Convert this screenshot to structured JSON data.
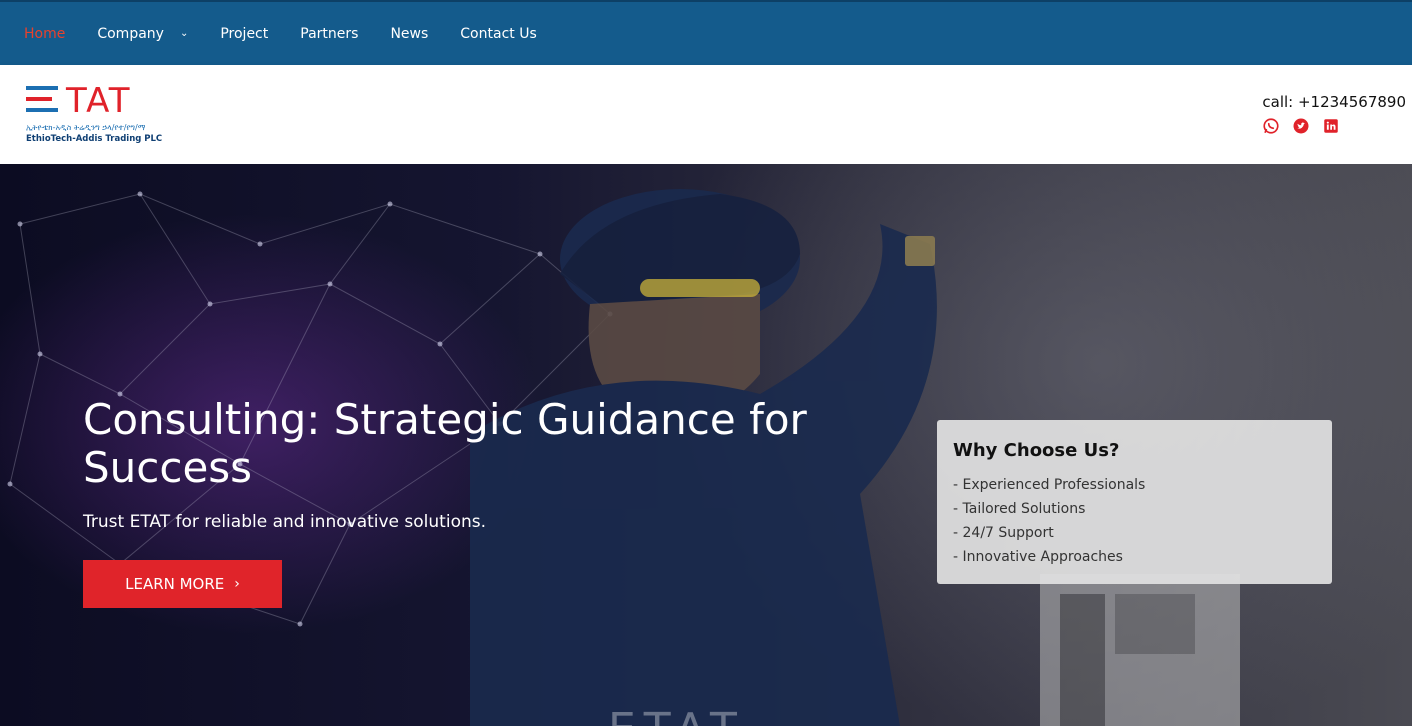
{
  "nav": {
    "items": [
      {
        "label": "Home",
        "active": true
      },
      {
        "label": "Company",
        "has_dropdown": true
      },
      {
        "label": "Project"
      },
      {
        "label": "Partners"
      },
      {
        "label": "News"
      },
      {
        "label": "Contact Us"
      }
    ],
    "background": "#145b8c",
    "active_color": "#e8412c"
  },
  "header": {
    "logo": {
      "mark": "TAT",
      "amharic": "ኢትዮቴክ-አዲስ ትሬዲንግ ኃላ/የተ/የግ/ማ",
      "company": "EthioTech-Addis Trading PLC"
    },
    "phone": "call: +1234567890",
    "social_icons": [
      "whatsapp-icon",
      "twitter-icon",
      "linkedin-icon"
    ],
    "accent_color": "#e0222a"
  },
  "hero": {
    "title": "Consulting: Strategic Guidance for Success",
    "subtitle": "Trust ETAT for reliable and innovative solutions.",
    "cta_label": "LEARN MORE",
    "cta_color": "#e0242a",
    "watermark": "ETAT",
    "why": {
      "title": "Why Choose Us?",
      "items": [
        "- Experienced Professionals",
        "- Tailored Solutions",
        "- 24/7 Support",
        "- Innovative Approaches"
      ]
    }
  }
}
